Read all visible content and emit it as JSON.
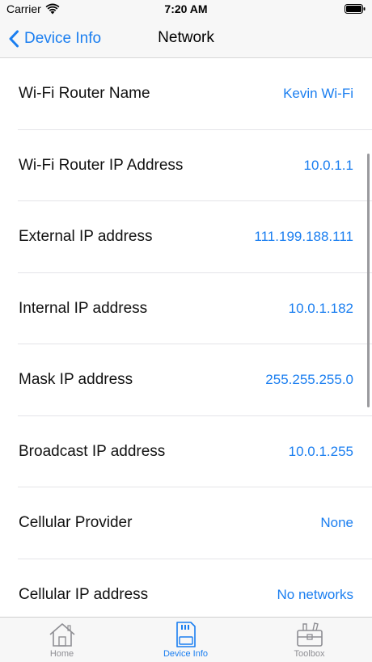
{
  "status_bar": {
    "carrier": "Carrier",
    "time": "7:20 AM",
    "wifi_icon": "wifi-icon",
    "battery_icon": "battery-icon"
  },
  "nav": {
    "back_label": "Device Info",
    "title": "Network"
  },
  "rows": [
    {
      "label": "Wi-Fi Router Name",
      "value": "Kevin Wi-Fi"
    },
    {
      "label": "Wi-Fi Router IP Address",
      "value": "10.0.1.1"
    },
    {
      "label": "External IP address",
      "value": "111.199.188.111"
    },
    {
      "label": "Internal IP address",
      "value": "10.0.1.182"
    },
    {
      "label": "Mask IP address",
      "value": "255.255.255.0"
    },
    {
      "label": "Broadcast IP address",
      "value": "10.0.1.255"
    },
    {
      "label": "Cellular Provider",
      "value": "None"
    },
    {
      "label": "Cellular IP address",
      "value": "No networks"
    }
  ],
  "tabs": [
    {
      "label": "Home",
      "icon": "home-icon",
      "active": false
    },
    {
      "label": "Device Info",
      "icon": "sd-card-icon",
      "active": true
    },
    {
      "label": "Toolbox",
      "icon": "toolbox-icon",
      "active": false
    }
  ],
  "colors": {
    "accent": "#1a7ef0",
    "inactive_tab": "#8e8e93",
    "background": "#f2f2f7"
  }
}
